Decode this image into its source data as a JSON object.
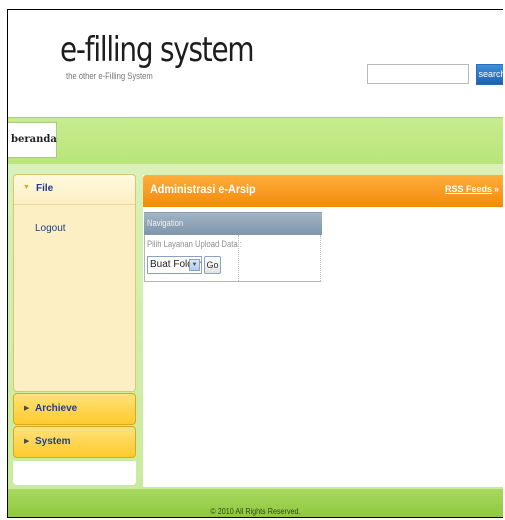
{
  "header": {
    "logo_title": "e-filling system",
    "logo_subtitle": "the other e-Filling System",
    "search_placeholder": "",
    "search_label": "search"
  },
  "navbar": {
    "tabs": [
      {
        "label": "beranda"
      }
    ]
  },
  "sidebar": {
    "file_label": "File",
    "logout_label": "Logout",
    "archive_label": "Archieve",
    "system_label": "System"
  },
  "content": {
    "title": "Administrasi e-Arsip",
    "rss_label": "RSS Feeds",
    "navigation": {
      "title": "Navigation",
      "prompt": "Pilih Layanan Upload Data :",
      "selected_option": "Buat Folder",
      "go_label": "Go"
    }
  },
  "footer": {
    "copyright": "© 2010 All Rights Reserved."
  },
  "colors": {
    "green_bar": "#b9e47a",
    "orange_header": "#f28a0c",
    "sidebar_panel": "#fbefc3",
    "yellow_bar": "#ffca2c",
    "link_blue": "#1d3e8e"
  }
}
